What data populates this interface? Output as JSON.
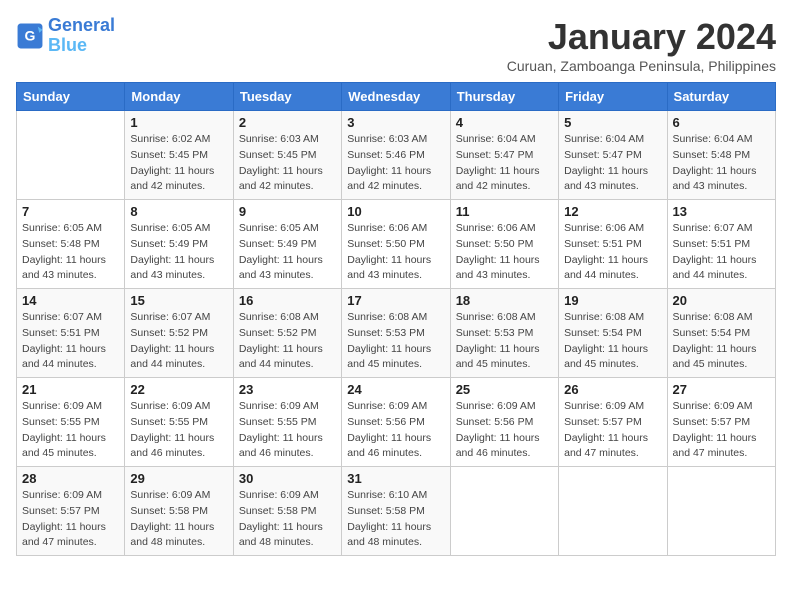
{
  "header": {
    "logo_line1": "General",
    "logo_line2": "Blue",
    "title": "January 2024",
    "subtitle": "Curuan, Zamboanga Peninsula, Philippines"
  },
  "weekdays": [
    "Sunday",
    "Monday",
    "Tuesday",
    "Wednesday",
    "Thursday",
    "Friday",
    "Saturday"
  ],
  "weeks": [
    [
      {
        "num": "",
        "sunrise": "",
        "sunset": "",
        "daylight": ""
      },
      {
        "num": "1",
        "sunrise": "Sunrise: 6:02 AM",
        "sunset": "Sunset: 5:45 PM",
        "daylight": "Daylight: 11 hours and 42 minutes."
      },
      {
        "num": "2",
        "sunrise": "Sunrise: 6:03 AM",
        "sunset": "Sunset: 5:45 PM",
        "daylight": "Daylight: 11 hours and 42 minutes."
      },
      {
        "num": "3",
        "sunrise": "Sunrise: 6:03 AM",
        "sunset": "Sunset: 5:46 PM",
        "daylight": "Daylight: 11 hours and 42 minutes."
      },
      {
        "num": "4",
        "sunrise": "Sunrise: 6:04 AM",
        "sunset": "Sunset: 5:47 PM",
        "daylight": "Daylight: 11 hours and 42 minutes."
      },
      {
        "num": "5",
        "sunrise": "Sunrise: 6:04 AM",
        "sunset": "Sunset: 5:47 PM",
        "daylight": "Daylight: 11 hours and 43 minutes."
      },
      {
        "num": "6",
        "sunrise": "Sunrise: 6:04 AM",
        "sunset": "Sunset: 5:48 PM",
        "daylight": "Daylight: 11 hours and 43 minutes."
      }
    ],
    [
      {
        "num": "7",
        "sunrise": "Sunrise: 6:05 AM",
        "sunset": "Sunset: 5:48 PM",
        "daylight": "Daylight: 11 hours and 43 minutes."
      },
      {
        "num": "8",
        "sunrise": "Sunrise: 6:05 AM",
        "sunset": "Sunset: 5:49 PM",
        "daylight": "Daylight: 11 hours and 43 minutes."
      },
      {
        "num": "9",
        "sunrise": "Sunrise: 6:05 AM",
        "sunset": "Sunset: 5:49 PM",
        "daylight": "Daylight: 11 hours and 43 minutes."
      },
      {
        "num": "10",
        "sunrise": "Sunrise: 6:06 AM",
        "sunset": "Sunset: 5:50 PM",
        "daylight": "Daylight: 11 hours and 43 minutes."
      },
      {
        "num": "11",
        "sunrise": "Sunrise: 6:06 AM",
        "sunset": "Sunset: 5:50 PM",
        "daylight": "Daylight: 11 hours and 43 minutes."
      },
      {
        "num": "12",
        "sunrise": "Sunrise: 6:06 AM",
        "sunset": "Sunset: 5:51 PM",
        "daylight": "Daylight: 11 hours and 44 minutes."
      },
      {
        "num": "13",
        "sunrise": "Sunrise: 6:07 AM",
        "sunset": "Sunset: 5:51 PM",
        "daylight": "Daylight: 11 hours and 44 minutes."
      }
    ],
    [
      {
        "num": "14",
        "sunrise": "Sunrise: 6:07 AM",
        "sunset": "Sunset: 5:51 PM",
        "daylight": "Daylight: 11 hours and 44 minutes."
      },
      {
        "num": "15",
        "sunrise": "Sunrise: 6:07 AM",
        "sunset": "Sunset: 5:52 PM",
        "daylight": "Daylight: 11 hours and 44 minutes."
      },
      {
        "num": "16",
        "sunrise": "Sunrise: 6:08 AM",
        "sunset": "Sunset: 5:52 PM",
        "daylight": "Daylight: 11 hours and 44 minutes."
      },
      {
        "num": "17",
        "sunrise": "Sunrise: 6:08 AM",
        "sunset": "Sunset: 5:53 PM",
        "daylight": "Daylight: 11 hours and 45 minutes."
      },
      {
        "num": "18",
        "sunrise": "Sunrise: 6:08 AM",
        "sunset": "Sunset: 5:53 PM",
        "daylight": "Daylight: 11 hours and 45 minutes."
      },
      {
        "num": "19",
        "sunrise": "Sunrise: 6:08 AM",
        "sunset": "Sunset: 5:54 PM",
        "daylight": "Daylight: 11 hours and 45 minutes."
      },
      {
        "num": "20",
        "sunrise": "Sunrise: 6:08 AM",
        "sunset": "Sunset: 5:54 PM",
        "daylight": "Daylight: 11 hours and 45 minutes."
      }
    ],
    [
      {
        "num": "21",
        "sunrise": "Sunrise: 6:09 AM",
        "sunset": "Sunset: 5:55 PM",
        "daylight": "Daylight: 11 hours and 45 minutes."
      },
      {
        "num": "22",
        "sunrise": "Sunrise: 6:09 AM",
        "sunset": "Sunset: 5:55 PM",
        "daylight": "Daylight: 11 hours and 46 minutes."
      },
      {
        "num": "23",
        "sunrise": "Sunrise: 6:09 AM",
        "sunset": "Sunset: 5:55 PM",
        "daylight": "Daylight: 11 hours and 46 minutes."
      },
      {
        "num": "24",
        "sunrise": "Sunrise: 6:09 AM",
        "sunset": "Sunset: 5:56 PM",
        "daylight": "Daylight: 11 hours and 46 minutes."
      },
      {
        "num": "25",
        "sunrise": "Sunrise: 6:09 AM",
        "sunset": "Sunset: 5:56 PM",
        "daylight": "Daylight: 11 hours and 46 minutes."
      },
      {
        "num": "26",
        "sunrise": "Sunrise: 6:09 AM",
        "sunset": "Sunset: 5:57 PM",
        "daylight": "Daylight: 11 hours and 47 minutes."
      },
      {
        "num": "27",
        "sunrise": "Sunrise: 6:09 AM",
        "sunset": "Sunset: 5:57 PM",
        "daylight": "Daylight: 11 hours and 47 minutes."
      }
    ],
    [
      {
        "num": "28",
        "sunrise": "Sunrise: 6:09 AM",
        "sunset": "Sunset: 5:57 PM",
        "daylight": "Daylight: 11 hours and 47 minutes."
      },
      {
        "num": "29",
        "sunrise": "Sunrise: 6:09 AM",
        "sunset": "Sunset: 5:58 PM",
        "daylight": "Daylight: 11 hours and 48 minutes."
      },
      {
        "num": "30",
        "sunrise": "Sunrise: 6:09 AM",
        "sunset": "Sunset: 5:58 PM",
        "daylight": "Daylight: 11 hours and 48 minutes."
      },
      {
        "num": "31",
        "sunrise": "Sunrise: 6:10 AM",
        "sunset": "Sunset: 5:58 PM",
        "daylight": "Daylight: 11 hours and 48 minutes."
      },
      {
        "num": "",
        "sunrise": "",
        "sunset": "",
        "daylight": ""
      },
      {
        "num": "",
        "sunrise": "",
        "sunset": "",
        "daylight": ""
      },
      {
        "num": "",
        "sunrise": "",
        "sunset": "",
        "daylight": ""
      }
    ]
  ]
}
